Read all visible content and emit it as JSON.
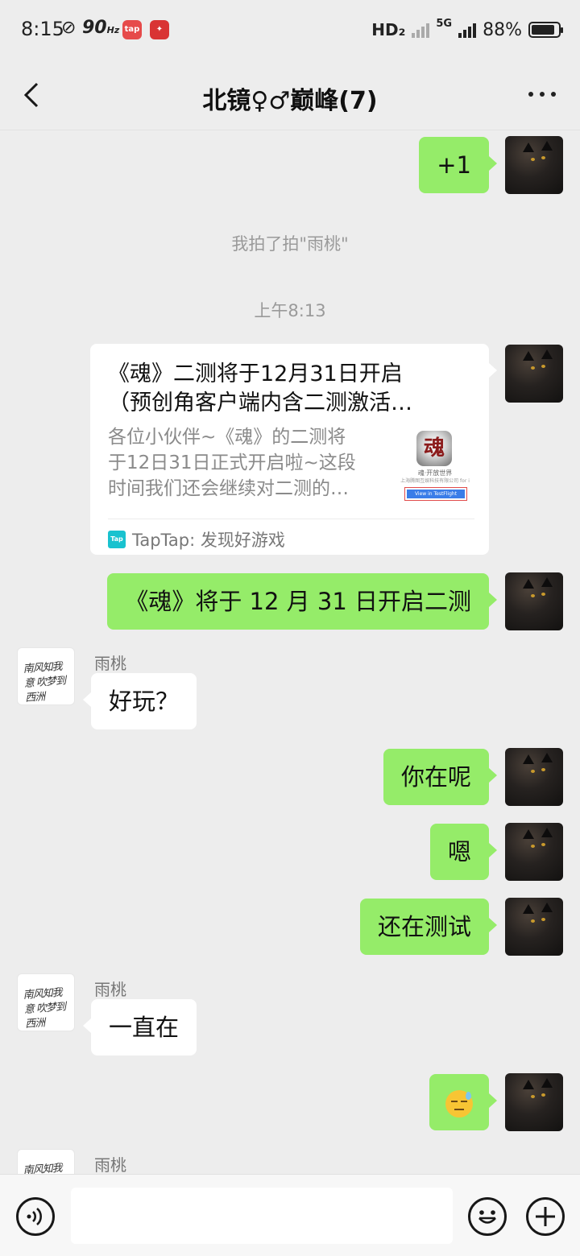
{
  "status_bar": {
    "time": "8:15",
    "refresh_rate": "90",
    "refresh_unit": "Hz",
    "tap_badge": "tap",
    "network_hd": "HD₂",
    "network_5g": "5G",
    "battery_percent": "88%"
  },
  "header": {
    "title": "北镜♀♂巅峰(7)"
  },
  "messages": {
    "m1": {
      "text": "+1"
    },
    "sys_pat": {
      "text": "我拍了拍\"雨桃\""
    },
    "timestamp": {
      "text": "上午8:13"
    },
    "card": {
      "title_line1": "《魂》二测将于12月31日开启",
      "title_line2": "（预创角客户端内含二测激活…",
      "desc_line1": "各位小伙伴~《魂》的二测将",
      "desc_line2": "于12日31日正式开启啦~这段",
      "desc_line3": "时间我们还会继续对二测的…",
      "thumb_char": "魂",
      "thumb_caption": "魂·开放世界",
      "thumb_company": "上海腾图互娱科技有限公司 for i",
      "thumb_button": "View in TestFlight",
      "source_icon_text": "Tap",
      "source": "TapTap: 发现好游戏"
    },
    "m2": {
      "text": "《魂》将于 12 月 31 日开启二测"
    },
    "in1": {
      "sender": "雨桃",
      "text": "好玩？"
    },
    "m3": {
      "text": "你在呢"
    },
    "m4": {
      "text": "嗯"
    },
    "m5": {
      "text": "还在测试"
    },
    "in2": {
      "sender": "雨桃",
      "text": "一直在"
    },
    "m6": {
      "emoji": "sweat-smile-emoji"
    },
    "in3": {
      "sender": "雨桃"
    }
  },
  "avatar_text": "南风知我意 吹梦到西洲",
  "input_bar": {
    "value": "",
    "placeholder": ""
  }
}
